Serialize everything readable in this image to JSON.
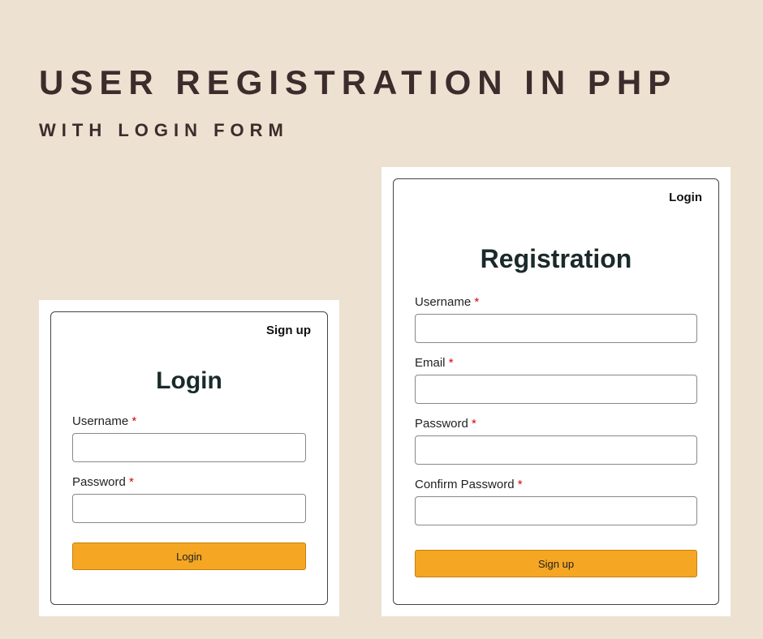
{
  "heading": {
    "main": "USER REGISTRATION IN PHP",
    "sub": "WITH LOGIN FORM"
  },
  "login": {
    "top_link": "Sign up",
    "title": "Login",
    "username_label": "Username",
    "password_label": "Password",
    "required_mark": "*",
    "submit": "Login"
  },
  "registration": {
    "top_link": "Login",
    "title": "Registration",
    "username_label": "Username",
    "email_label": "Email",
    "password_label": "Password",
    "confirm_label": "Confirm Password",
    "required_mark": "*",
    "submit": "Sign up"
  }
}
